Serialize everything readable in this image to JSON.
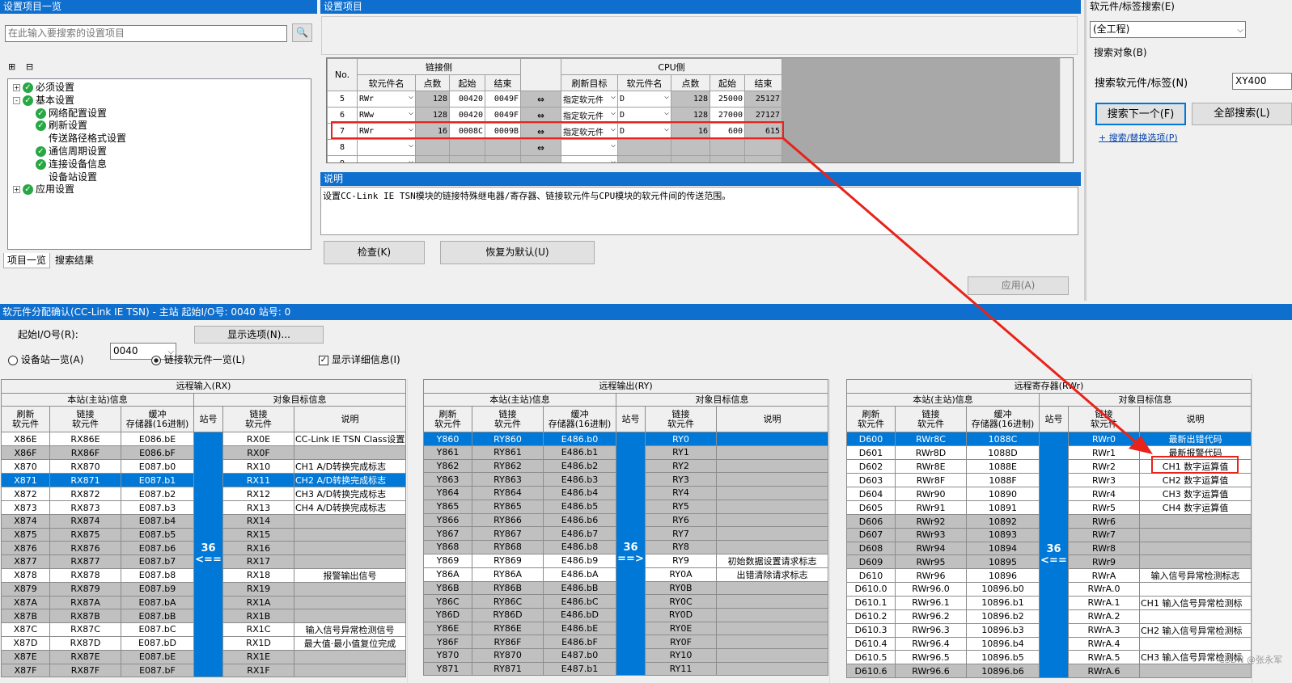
{
  "left_panel": {
    "title": "设置项目一览",
    "search_placeholder": "在此输入要搜索的设置项目",
    "tabs": [
      "项目一览",
      "搜索结果"
    ],
    "tree": [
      {
        "label": "必须设置",
        "level": 0,
        "check": true,
        "exp": "+"
      },
      {
        "label": "基本设置",
        "level": 0,
        "check": true,
        "exp": "-"
      },
      {
        "label": "网络配置设置",
        "level": 1,
        "check": true
      },
      {
        "label": "刷新设置",
        "level": 1,
        "check": true
      },
      {
        "label": "传送路径格式设置",
        "level": 1,
        "check": false
      },
      {
        "label": "通信周期设置",
        "level": 1,
        "check": true
      },
      {
        "label": "连接设备信息",
        "level": 1,
        "check": true
      },
      {
        "label": "设备站设置",
        "level": 1,
        "check": false
      },
      {
        "label": "应用设置",
        "level": 0,
        "check": true,
        "exp": "+"
      }
    ]
  },
  "settings": {
    "title": "设置项目",
    "link_side": "链接侧",
    "cpu_side": "CPU侧",
    "headers": [
      "No.",
      "软元件名",
      "点数",
      "起始",
      "结束",
      "刷新目标",
      "软元件名",
      "点数",
      "起始",
      "结束"
    ],
    "rows": [
      {
        "no": "5",
        "dev": "RWr",
        "pts": "128",
        "start": "00420",
        "end": "0049F",
        "target": "指定软元件",
        "cdev": "D",
        "cpts": "128",
        "cstart": "25000",
        "cend": "25127"
      },
      {
        "no": "6",
        "dev": "RWw",
        "pts": "128",
        "start": "00420",
        "end": "0049F",
        "target": "指定软元件",
        "cdev": "D",
        "cpts": "128",
        "cstart": "27000",
        "cend": "27127"
      },
      {
        "no": "7",
        "dev": "RWr",
        "pts": "16",
        "start": "0008C",
        "end": "0009B",
        "target": "指定软元件",
        "cdev": "D",
        "cpts": "16",
        "cstart": "600",
        "cend": "615"
      },
      {
        "no": "8",
        "dev": "",
        "pts": "",
        "start": "",
        "end": "",
        "target": "",
        "cdev": "",
        "cpts": "",
        "cstart": "",
        "cend": ""
      },
      {
        "no": "9",
        "dev": "",
        "pts": "",
        "start": "",
        "end": "",
        "target": "",
        "cdev": "",
        "cpts": "",
        "cstart": "",
        "cend": ""
      }
    ]
  },
  "description": {
    "title": "说明",
    "text": "设置CC-Link IE TSN模块的链接特殊继电器/寄存器、链接软元件与CPU模块的软元件间的传送范围。"
  },
  "buttons": {
    "check": "检查(K)",
    "restore": "恢复为默认(U)",
    "apply": "应用(A)"
  },
  "search_panel": {
    "title": "软元件/标签搜索(E)",
    "scope": "(全工程)",
    "target": "搜索对象(B)",
    "label": "搜索软元件/标签(N)",
    "value": "XY400",
    "find_next": "搜索下一个(F)",
    "find_all": "全部搜索(L)",
    "options": "+ 搜索/替换选项(P)"
  },
  "bottom": {
    "title": "软元件分配确认(CC-Link IE TSN) - 主站 起始I/O号: 0040 站号: 0",
    "io_label": "起始I/O号(R):",
    "io_value": "0040",
    "display_btn": "显示选项(N)...",
    "radio1": "设备站一览(A)",
    "radio2": "链接软元件一览(L)",
    "checkbox": "显示详细信息(I)",
    "sub_hdr": {
      "local": "本站(主站)信息",
      "target": "对象目标信息",
      "refresh": "刷新\n软元件",
      "link": "链接\n软元件",
      "buffer": "缓冲\n存储器(16进制)",
      "station": "站号",
      "tlink": "链接\n软元件",
      "desc": "说明"
    },
    "rx": {
      "title": "远程输入(RX)",
      "station": "36",
      "arrow": "<==",
      "rows": [
        [
          "X86E",
          "RX86E",
          "E086.bE",
          "RX0E",
          "CC-Link IE TSN Class设置"
        ],
        [
          "X86F",
          "RX86F",
          "E086.bF",
          "RX0F",
          ""
        ],
        [
          "X870",
          "RX870",
          "E087.b0",
          "RX10",
          "CH1 A/D转换完成标志"
        ],
        [
          "X871",
          "RX871",
          "E087.b1",
          "RX11",
          "CH2 A/D转换完成标志"
        ],
        [
          "X872",
          "RX872",
          "E087.b2",
          "RX12",
          "CH3 A/D转换完成标志"
        ],
        [
          "X873",
          "RX873",
          "E087.b3",
          "RX13",
          "CH4 A/D转换完成标志"
        ],
        [
          "X874",
          "RX874",
          "E087.b4",
          "RX14",
          ""
        ],
        [
          "X875",
          "RX875",
          "E087.b5",
          "RX15",
          ""
        ],
        [
          "X876",
          "RX876",
          "E087.b6",
          "RX16",
          ""
        ],
        [
          "X877",
          "RX877",
          "E087.b7",
          "RX17",
          ""
        ],
        [
          "X878",
          "RX878",
          "E087.b8",
          "RX18",
          "报警输出信号"
        ],
        [
          "X879",
          "RX879",
          "E087.b9",
          "RX19",
          ""
        ],
        [
          "X87A",
          "RX87A",
          "E087.bA",
          "RX1A",
          ""
        ],
        [
          "X87B",
          "RX87B",
          "E087.bB",
          "RX1B",
          ""
        ],
        [
          "X87C",
          "RX87C",
          "E087.bC",
          "RX1C",
          "输入信号异常检测信号"
        ],
        [
          "X87D",
          "RX87D",
          "E087.bD",
          "RX1D",
          "最大值·最小值复位完成"
        ],
        [
          "X87E",
          "RX87E",
          "E087.bE",
          "RX1E",
          ""
        ],
        [
          "X87F",
          "RX87F",
          "E087.bF",
          "RX1F",
          ""
        ]
      ]
    },
    "ry": {
      "title": "远程输出(RY)",
      "station": "36",
      "arrow": "==>",
      "rows": [
        [
          "Y860",
          "RY860",
          "E486.b0",
          "RY0",
          ""
        ],
        [
          "Y861",
          "RY861",
          "E486.b1",
          "RY1",
          ""
        ],
        [
          "Y862",
          "RY862",
          "E486.b2",
          "RY2",
          ""
        ],
        [
          "Y863",
          "RY863",
          "E486.b3",
          "RY3",
          ""
        ],
        [
          "Y864",
          "RY864",
          "E486.b4",
          "RY4",
          ""
        ],
        [
          "Y865",
          "RY865",
          "E486.b5",
          "RY5",
          ""
        ],
        [
          "Y866",
          "RY866",
          "E486.b6",
          "RY6",
          ""
        ],
        [
          "Y867",
          "RY867",
          "E486.b7",
          "RY7",
          ""
        ],
        [
          "Y868",
          "RY868",
          "E486.b8",
          "RY8",
          ""
        ],
        [
          "Y869",
          "RY869",
          "E486.b9",
          "RY9",
          "初始数据设置请求标志"
        ],
        [
          "Y86A",
          "RY86A",
          "E486.bA",
          "RY0A",
          "出错清除请求标志"
        ],
        [
          "Y86B",
          "RY86B",
          "E486.bB",
          "RY0B",
          ""
        ],
        [
          "Y86C",
          "RY86C",
          "E486.bC",
          "RY0C",
          ""
        ],
        [
          "Y86D",
          "RY86D",
          "E486.bD",
          "RY0D",
          ""
        ],
        [
          "Y86E",
          "RY86E",
          "E486.bE",
          "RY0E",
          ""
        ],
        [
          "Y86F",
          "RY86F",
          "E486.bF",
          "RY0F",
          ""
        ],
        [
          "Y870",
          "RY870",
          "E487.b0",
          "RY10",
          ""
        ],
        [
          "Y871",
          "RY871",
          "E487.b1",
          "RY11",
          ""
        ]
      ]
    },
    "rwr": {
      "title": "远程寄存器(RWr)",
      "station": "36",
      "arrow": "<==",
      "rows": [
        [
          "D600",
          "RWr8C",
          "1088C",
          "RWr0",
          "最新出错代码"
        ],
        [
          "D601",
          "RWr8D",
          "1088D",
          "RWr1",
          "最新报警代码"
        ],
        [
          "D602",
          "RWr8E",
          "1088E",
          "RWr2",
          "CH1 数字运算值"
        ],
        [
          "D603",
          "RWr8F",
          "1088F",
          "RWr3",
          "CH2 数字运算值"
        ],
        [
          "D604",
          "RWr90",
          "10890",
          "RWr4",
          "CH3 数字运算值"
        ],
        [
          "D605",
          "RWr91",
          "10891",
          "RWr5",
          "CH4 数字运算值"
        ],
        [
          "D606",
          "RWr92",
          "10892",
          "RWr6",
          ""
        ],
        [
          "D607",
          "RWr93",
          "10893",
          "RWr7",
          ""
        ],
        [
          "D608",
          "RWr94",
          "10894",
          "RWr8",
          ""
        ],
        [
          "D609",
          "RWr95",
          "10895",
          "RWr9",
          ""
        ],
        [
          "D610",
          "RWr96",
          "10896",
          "RWrA",
          "输入信号异常检测标志"
        ],
        [
          "D610.0",
          "RWr96.0",
          "10896.b0",
          "RWrA.0",
          ""
        ],
        [
          "D610.1",
          "RWr96.1",
          "10896.b1",
          "RWrA.1",
          "CH1 输入信号异常检测标"
        ],
        [
          "D610.2",
          "RWr96.2",
          "10896.b2",
          "RWrA.2",
          ""
        ],
        [
          "D610.3",
          "RWr96.3",
          "10896.b3",
          "RWrA.3",
          "CH2 输入信号异常检测标"
        ],
        [
          "D610.4",
          "RWr96.4",
          "10896.b4",
          "RWrA.4",
          ""
        ],
        [
          "D610.5",
          "RWr96.5",
          "10896.b5",
          "RWrA.5",
          "CH3 输入信号异常检测标"
        ],
        [
          "D610.6",
          "RWr96.6",
          "10896.b6",
          "RWrA.6",
          ""
        ]
      ]
    }
  },
  "watermark": "CSDN @张永军",
  "colors": {
    "accent": "#0f6fce",
    "selection": "#0078d7",
    "highlight": "#e8231a"
  }
}
